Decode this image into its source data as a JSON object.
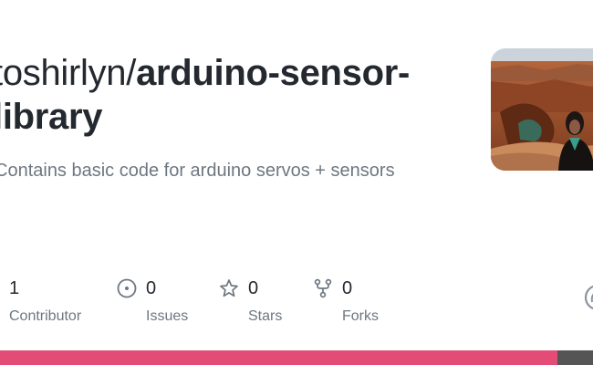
{
  "repo": {
    "owner": "toshirlyn/",
    "name": "arduino-sensor-library",
    "description": "Contains basic code for arduino servos + sensors"
  },
  "stats": [
    {
      "value": "1",
      "label": "Contributor",
      "icon": "people-icon"
    },
    {
      "value": "0",
      "label": "Issues",
      "icon": "issue-opened-icon"
    },
    {
      "value": "0",
      "label": "Stars",
      "icon": "star-icon"
    },
    {
      "value": "0",
      "label": "Forks",
      "icon": "repo-forked-icon"
    }
  ],
  "colors": {
    "language_primary": "#e34c76",
    "language_secondary": "#555555"
  },
  "language_bar": [
    {
      "fraction": 0.94
    },
    {
      "fraction": 0.06
    }
  ]
}
